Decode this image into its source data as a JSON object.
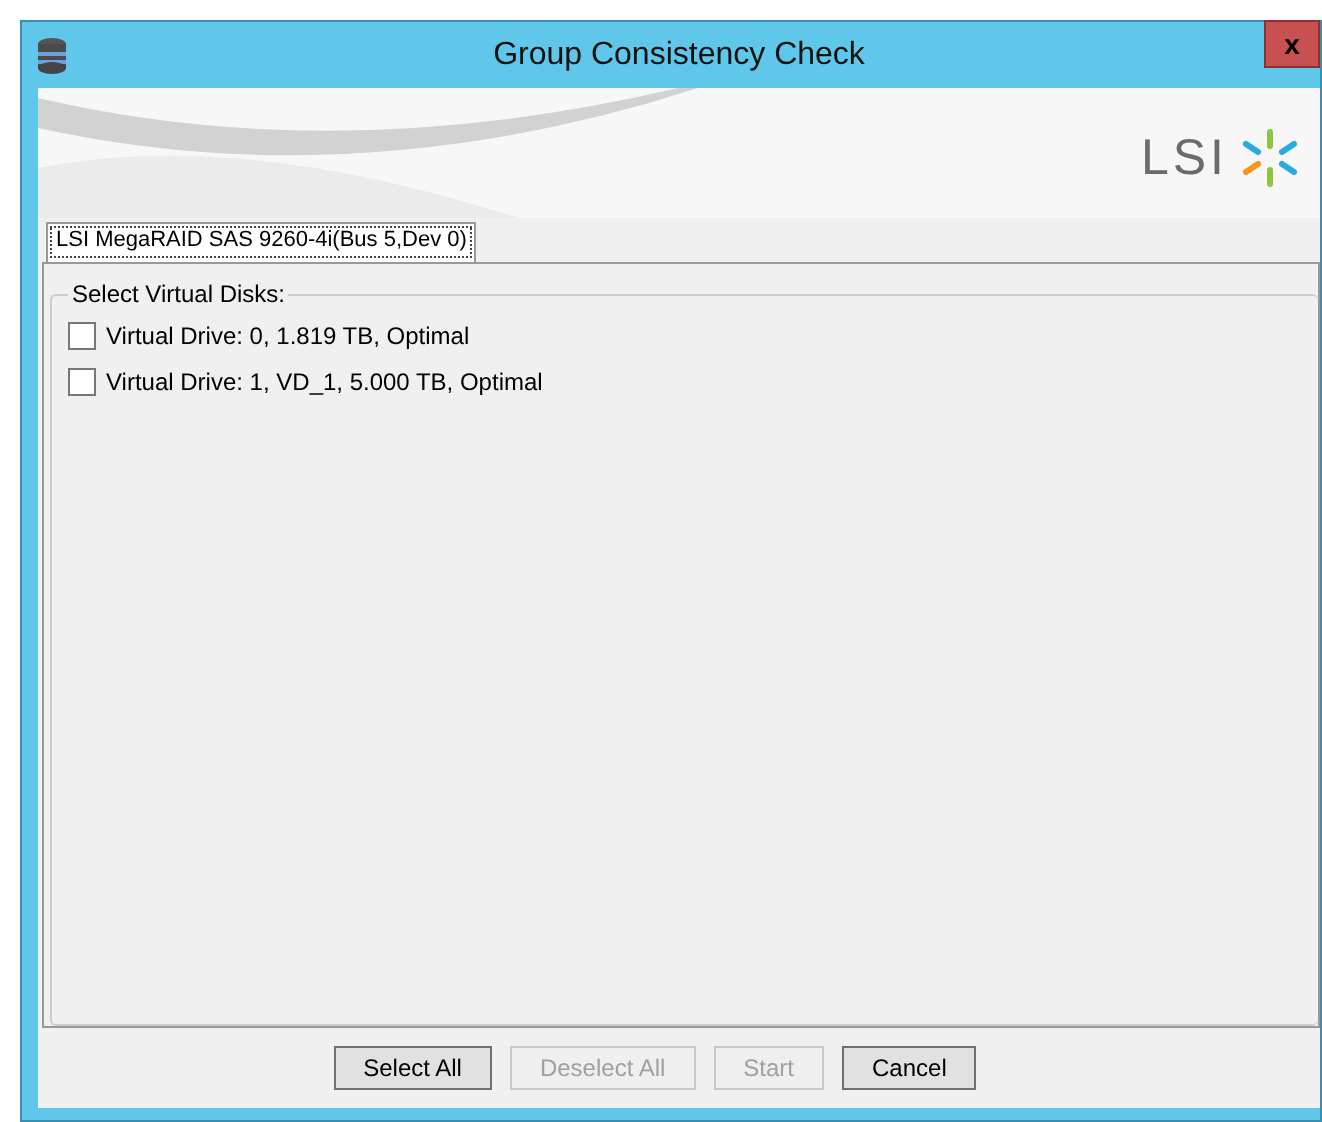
{
  "window": {
    "title": "Group Consistency Check",
    "close": "x"
  },
  "banner": {
    "logo": "LSI"
  },
  "tabs": [
    {
      "label": "LSI MegaRAID SAS 9260-4i(Bus 5,Dev 0)",
      "selected": true
    }
  ],
  "group": {
    "title": "Select Virtual Disks:",
    "items": [
      {
        "label": "Virtual Drive: 0, 1.819 TB, Optimal",
        "checked": false
      },
      {
        "label": "Virtual Drive: 1, VD_1, 5.000 TB, Optimal",
        "checked": false
      }
    ]
  },
  "buttons": [
    {
      "label": "Select All",
      "disabled": false
    },
    {
      "label": "Deselect All",
      "disabled": true
    },
    {
      "label": "Start",
      "disabled": true
    },
    {
      "label": "Cancel",
      "disabled": false
    }
  ]
}
